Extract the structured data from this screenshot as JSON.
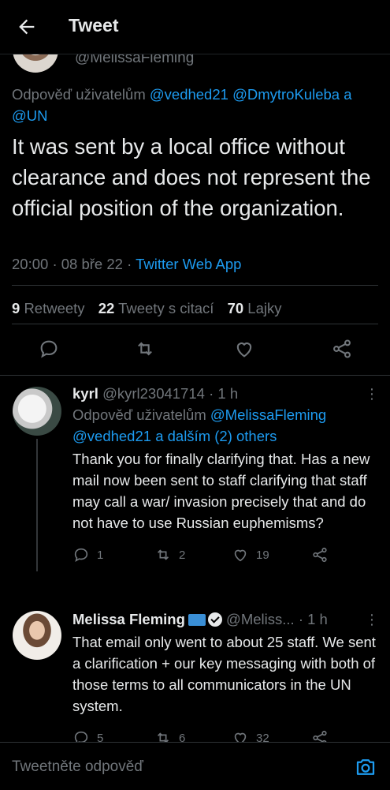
{
  "header": {
    "title": "Tweet"
  },
  "main_tweet": {
    "author_handle": "@MelissaFleming",
    "reply_prefix": "Odpověď uživatelům",
    "reply_mentions": [
      "@vedhed21",
      "@DmytroKuleba"
    ],
    "reply_and": "a",
    "reply_last_mention": "@UN",
    "text": "It was sent by a local office without clearance and does not represent the official position of the organization.",
    "time": "20:00",
    "date": "08 bře 22",
    "source": "Twitter Web App",
    "stats": {
      "retweets_count": "9",
      "retweets_label": "Retweety",
      "quotes_count": "22",
      "quotes_label": "Tweety s citací",
      "likes_count": "70",
      "likes_label": "Lajky"
    }
  },
  "replies": [
    {
      "name": "kyrl",
      "handle": "@kyrl23041714",
      "time": "1 h",
      "reply_prefix": "Odpověď uživatelům",
      "reply_targets": "@MelissaFleming @vedhed21 a dalším (2) others",
      "text": "Thank you for finally clarifying that.  Has a new mail now been sent to staff clarifying that staff may call a war/ invasion precisely that and do not have to use Russian euphemisms?",
      "reply_count": "1",
      "retweet_count": "2",
      "like_count": "19"
    },
    {
      "name": "Melissa Fleming",
      "handle": "@Meliss...",
      "time": "1 h",
      "text": "That email only went to about 25 staff. We sent a clarification + our key messaging with both of those terms to all communicators in the UN system.",
      "reply_count": "5",
      "retweet_count": "6",
      "like_count": "32"
    }
  ],
  "compose": {
    "placeholder": "Tweetněte odpověď"
  },
  "colors": {
    "accent": "#1d9bf0",
    "muted": "#71767b",
    "text": "#e7e9ea",
    "background": "#000000"
  },
  "icons": [
    "back-arrow-icon",
    "reply-icon",
    "retweet-icon",
    "like-icon",
    "share-icon",
    "more-icon",
    "verified-icon",
    "flag-icon",
    "camera-icon"
  ]
}
